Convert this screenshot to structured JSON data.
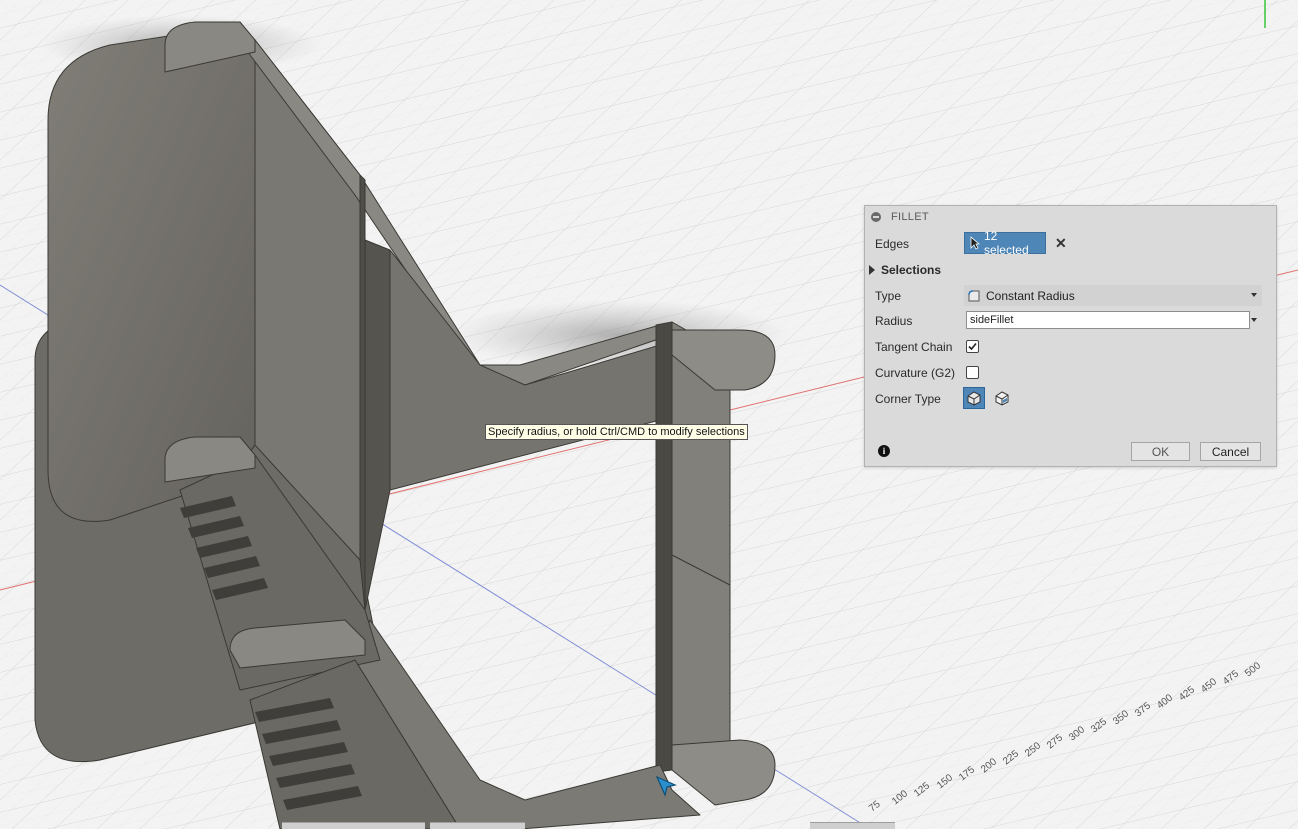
{
  "viewport": {
    "tooltip": "Specify radius, or hold Ctrl/CMD to modify selections",
    "axis_ticks": [
      "75",
      "100",
      "125",
      "150",
      "175",
      "200",
      "225",
      "250",
      "275",
      "300",
      "325",
      "350",
      "375",
      "400",
      "425",
      "450",
      "475",
      "500"
    ]
  },
  "dialog": {
    "title": "FILLET",
    "edges": {
      "label": "Edges",
      "selection": "12 selected"
    },
    "selections": {
      "label": "Selections"
    },
    "type": {
      "label": "Type",
      "value": "Constant Radius"
    },
    "radius": {
      "label": "Radius",
      "value": "sideFillet"
    },
    "tangent_chain": {
      "label": "Tangent Chain",
      "checked": true
    },
    "curvature": {
      "label": "Curvature (G2)",
      "checked": false
    },
    "corner_type": {
      "label": "Corner Type",
      "options": [
        "rolling-ball-corner-icon",
        "setback-corner-icon"
      ],
      "selected": 0
    },
    "ok_label": "OK",
    "cancel_label": "Cancel"
  },
  "colors": {
    "accent": "#4d86b7",
    "model_face": "#72706a",
    "model_edge": "#3a3934",
    "background": "#f3f3f3"
  }
}
